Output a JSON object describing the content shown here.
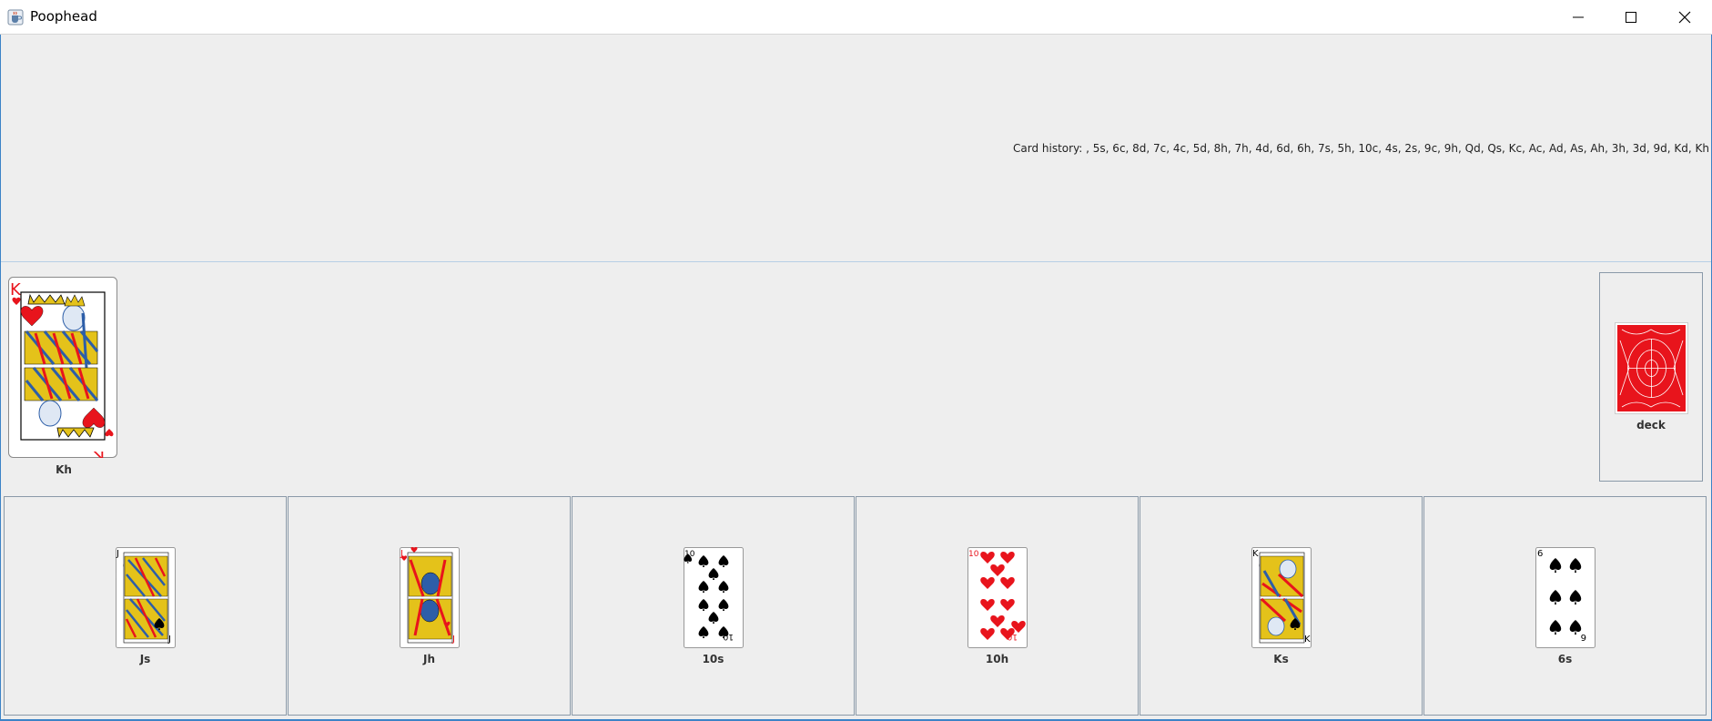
{
  "window": {
    "title": "Poophead",
    "icon": "java-cup-icon",
    "controls": [
      "minimize-icon",
      "maximize-icon",
      "close-icon"
    ]
  },
  "info": {
    "history": "Card history: , 5s, 6c, 8d, 7c, 4c, 5d, 8h, 7h, 4d, 6d, 6h, 7s, 5h, 10c, 4s, 2s, 9c, 9h, Qd, Qs, Kc, Ac, Ad, As, Ah, 3h, 3d, 9d, Kd, Kh"
  },
  "pile": {
    "top_card": "Kh"
  },
  "deck": {
    "label": "deck"
  },
  "hand": [
    {
      "label": "Js"
    },
    {
      "label": "Jh"
    },
    {
      "label": "10s"
    },
    {
      "label": "10h"
    },
    {
      "label": "Ks"
    },
    {
      "label": "6s"
    }
  ],
  "colors": {
    "red_suit": "#e8141c",
    "black_suit": "#000000",
    "deck_back": "#e8141c",
    "frame_border": "#3c83c7"
  }
}
